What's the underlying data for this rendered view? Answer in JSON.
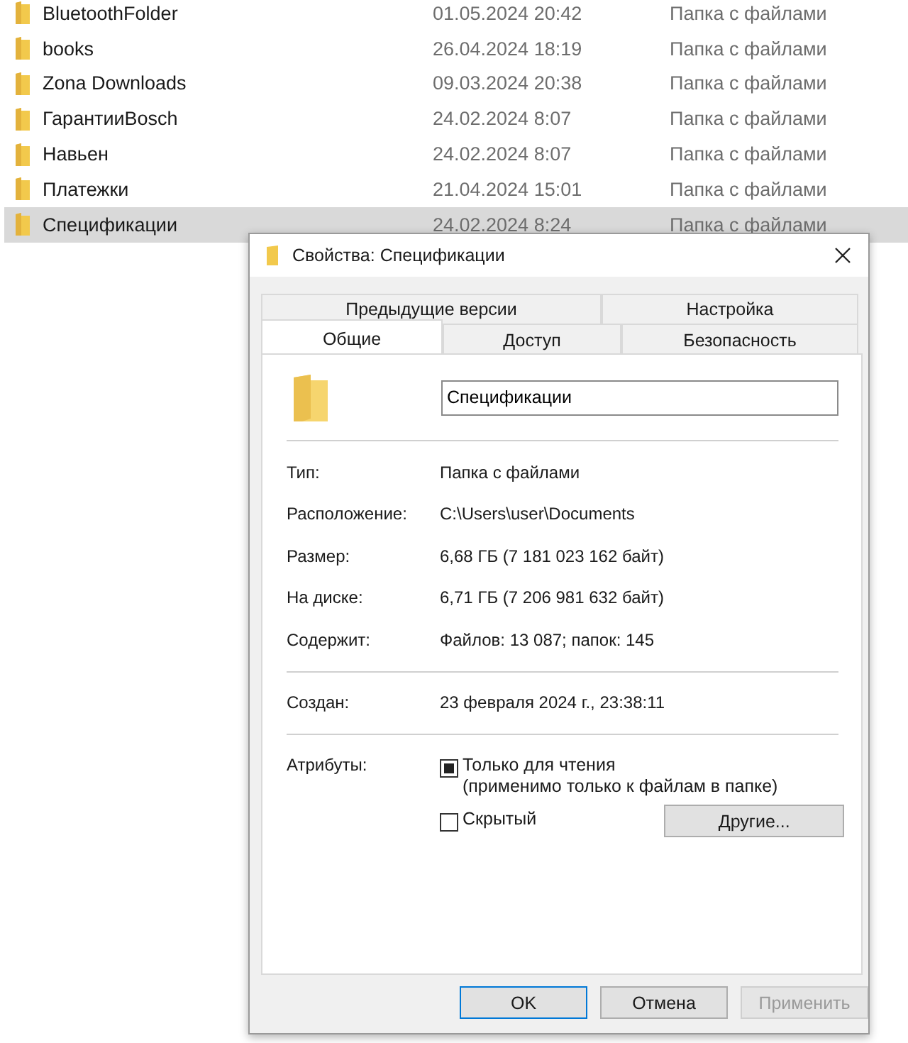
{
  "file_list": [
    {
      "name": "BluetoothFolder",
      "modified": "01.05.2024 20:42",
      "type": "Папка с файлами",
      "selected": false
    },
    {
      "name": "books",
      "modified": "26.04.2024 18:19",
      "type": "Папка с файлами",
      "selected": false
    },
    {
      "name": "Zona Downloads",
      "modified": "09.03.2024 20:38",
      "type": "Папка с файлами",
      "selected": false
    },
    {
      "name": "ГарантииBosch",
      "modified": "24.02.2024 8:07",
      "type": "Папка с файлами",
      "selected": false
    },
    {
      "name": "Навьен",
      "modified": "24.02.2024 8:07",
      "type": "Папка с файлами",
      "selected": false
    },
    {
      "name": "Платежки",
      "modified": "21.04.2024 15:01",
      "type": "Папка с файлами",
      "selected": false
    },
    {
      "name": "Спецификации",
      "modified": "24.02.2024 8:24",
      "type": "Папка с файлами",
      "selected": true
    }
  ],
  "dialog": {
    "title": "Свойства: Спецификации",
    "tab_rows": [
      {
        "tabs": [
          {
            "label": "Предыдущие версии",
            "selected": false
          },
          {
            "label": "Настройка",
            "selected": false
          }
        ]
      },
      {
        "tabs": [
          {
            "label": "Общие",
            "selected": true
          },
          {
            "label": "Доступ",
            "selected": false
          },
          {
            "label": "Безопасность",
            "selected": false
          }
        ]
      }
    ],
    "folder_name": "Спецификации",
    "sections": [
      {
        "rows": [
          {
            "label": "Тип:",
            "value": "Папка с файлами"
          },
          {
            "label": "Расположение:",
            "value": "C:\\Users\\user\\Documents"
          },
          {
            "label": "Размер:",
            "value": "6,68 ГБ (7 181 023 162 байт)"
          },
          {
            "label": "На диске:",
            "value": "6,71 ГБ (7 206 981 632 байт)"
          },
          {
            "label": "Содержит:",
            "value": "Файлов: 13 087; папок: 145"
          }
        ]
      },
      {
        "rows": [
          {
            "label": "Создан:",
            "value": "23 февраля 2024 г., 23:38:11"
          }
        ]
      }
    ],
    "attributes": {
      "label": "Атрибуты:",
      "options": [
        {
          "label": "Только для чтения",
          "note": "(применимо только к файлам в папке)",
          "checked": true,
          "indeterminate": true
        },
        {
          "label": "Скрытый",
          "checked": false
        }
      ],
      "other_button": "Другие..."
    },
    "buttons": [
      {
        "label": "OK",
        "default": true,
        "disabled": false
      },
      {
        "label": "Отмена",
        "default": false,
        "disabled": false
      },
      {
        "label": "Применить",
        "default": false,
        "disabled": true
      }
    ]
  }
}
